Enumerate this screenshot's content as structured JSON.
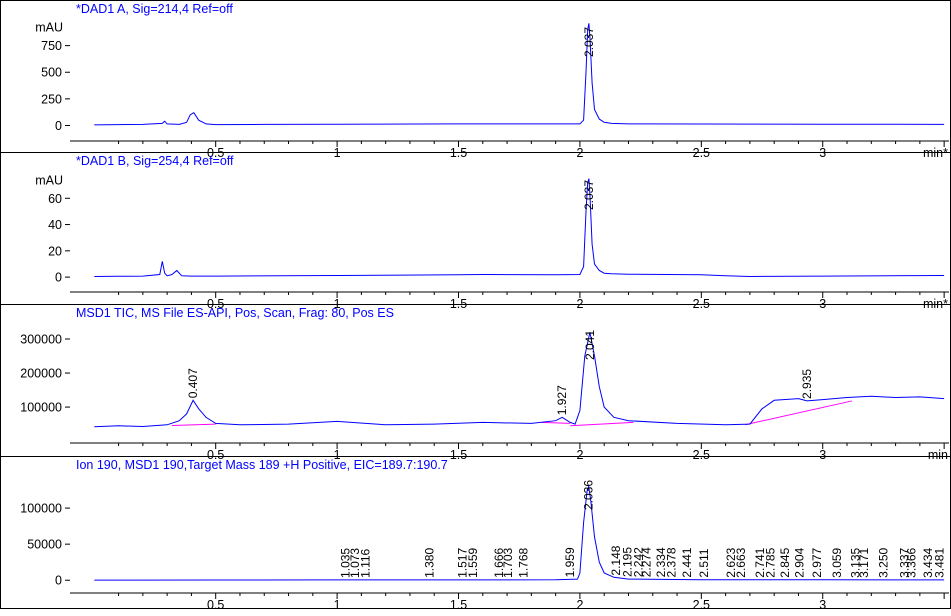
{
  "chart_data": [
    {
      "type": "line",
      "title": "*DAD1 A, Sig=214,4 Ref=off",
      "ylabel": "mAU",
      "xunit": "min*",
      "xlim": [
        -0.1,
        3.52
      ],
      "ylim": [
        -80,
        1000
      ],
      "yticks": [
        0,
        250,
        500,
        750
      ],
      "xticks": [
        0.5,
        1,
        1.5,
        2,
        2.5,
        3
      ],
      "trace_color": "#0000ff",
      "baseline_color": "#ff00ff",
      "series": [
        {
          "x": [
            0,
            0.1,
            0.2,
            0.28,
            0.29,
            0.3,
            0.35,
            0.38,
            0.395,
            0.41,
            0.43,
            0.46,
            0.5,
            0.7,
            1.0,
            1.5,
            1.9,
            2.0,
            2.015,
            2.025,
            2.032,
            2.037,
            2.042,
            2.05,
            2.06,
            2.08,
            2.1,
            2.13,
            2.2,
            2.5,
            3.0,
            3.5
          ],
          "y": [
            5,
            8,
            10,
            20,
            40,
            15,
            10,
            30,
            100,
            120,
            50,
            15,
            8,
            10,
            12,
            15,
            15,
            15,
            50,
            500,
            900,
            960,
            800,
            400,
            150,
            60,
            30,
            20,
            15,
            14,
            12,
            10
          ]
        }
      ],
      "peaks": [
        {
          "rt": 2.037,
          "label": "2.037"
        }
      ]
    },
    {
      "type": "line",
      "title": "*DAD1 B, Sig=254,4 Ref=off",
      "ylabel": "mAU",
      "xunit": "min*",
      "xlim": [
        -0.1,
        3.52
      ],
      "ylim": [
        -6,
        80
      ],
      "yticks": [
        0,
        20,
        40,
        60
      ],
      "xticks": [
        0.5,
        1,
        1.5,
        2,
        2.5,
        3
      ],
      "trace_color": "#0000ff",
      "baseline_color": "#ff00ff",
      "series": [
        {
          "x": [
            0,
            0.1,
            0.2,
            0.27,
            0.28,
            0.29,
            0.3,
            0.32,
            0.34,
            0.36,
            0.4,
            0.5,
            1.0,
            1.5,
            1.6,
            1.9,
            2.0,
            2.015,
            2.025,
            2.032,
            2.037,
            2.042,
            2.05,
            2.06,
            2.08,
            2.1,
            2.13,
            2.2,
            2.5,
            2.6,
            2.7,
            3.0,
            3.5
          ],
          "y": [
            0.5,
            0.6,
            0.8,
            2,
            12,
            3,
            1,
            2,
            5,
            1,
            0.8,
            0.8,
            1.2,
            1.8,
            2,
            1.8,
            2,
            8,
            50,
            72,
            75,
            60,
            25,
            10,
            5,
            3,
            2.5,
            2.2,
            1.8,
            1.0,
            0.5,
            0.8,
            1.2
          ]
        }
      ],
      "peaks": [
        {
          "rt": 2.037,
          "label": "2.037"
        }
      ]
    },
    {
      "type": "line",
      "title": "MSD1 TIC, MS File     ES-API, Pos, Scan, Frag: 80, Pos ES",
      "ylabel": "",
      "xunit": "min",
      "xlim": [
        -0.1,
        3.52
      ],
      "ylim": [
        15000,
        350000
      ],
      "yticks": [
        100000,
        200000,
        300000
      ],
      "xticks": [
        0.5,
        1,
        1.5,
        2,
        2.5,
        3
      ],
      "trace_color": "#0000ff",
      "baseline_color": "#ff00ff",
      "series": [
        {
          "x": [
            0,
            0.1,
            0.2,
            0.3,
            0.35,
            0.38,
            0.407,
            0.43,
            0.46,
            0.5,
            0.6,
            0.8,
            1.0,
            1.2,
            1.4,
            1.6,
            1.8,
            1.9,
            1.927,
            1.96,
            1.98,
            2.0,
            2.02,
            2.041,
            2.06,
            2.08,
            2.1,
            2.14,
            2.2,
            2.4,
            2.6,
            2.7,
            2.75,
            2.8,
            2.9,
            2.935,
            3.0,
            3.1,
            3.2,
            3.3,
            3.4,
            3.5
          ],
          "y": [
            42000,
            45000,
            43000,
            48000,
            60000,
            80000,
            120000,
            95000,
            70000,
            52000,
            48000,
            50000,
            58000,
            48000,
            50000,
            55000,
            52000,
            60000,
            70000,
            55000,
            50000,
            90000,
            250000,
            320000,
            250000,
            160000,
            100000,
            70000,
            60000,
            52000,
            48000,
            50000,
            95000,
            120000,
            125000,
            118000,
            122000,
            128000,
            132000,
            128000,
            130000,
            125000
          ]
        }
      ],
      "baselines": [
        {
          "x": [
            0.32,
            0.5
          ],
          "y": [
            46000,
            50000
          ]
        },
        {
          "x": [
            1.84,
            1.96
          ],
          "y": [
            55000,
            52000
          ]
        },
        {
          "x": [
            1.96,
            2.22
          ],
          "y": [
            45000,
            55000
          ]
        },
        {
          "x": [
            2.68,
            3.12
          ],
          "y": [
            48000,
            118000
          ]
        }
      ],
      "peaks": [
        {
          "rt": 0.407,
          "label": "0.407"
        },
        {
          "rt": 1.927,
          "label": "1.927"
        },
        {
          "rt": 2.041,
          "label": "2.041"
        },
        {
          "rt": 2.935,
          "label": "2.935"
        }
      ]
    },
    {
      "type": "line",
      "title": "Ion 190, MSD1 190,Target Mass 189 +H Positive, EIC=189.7:190.7",
      "ylabel": "",
      "xunit": "",
      "xlim": [
        -0.1,
        3.52
      ],
      "ylim": [
        -8000,
        150000
      ],
      "yticks": [
        0,
        50000,
        100000
      ],
      "xticks": [
        0.5,
        1,
        1.5,
        2,
        2.5,
        3
      ],
      "trace_color": "#0000ff",
      "baseline_color": "#ff00ff",
      "series": [
        {
          "x": [
            0,
            0.5,
            1.0,
            1.5,
            1.9,
            1.99,
            2.0,
            2.015,
            2.03,
            2.036,
            2.045,
            2.06,
            2.08,
            2.1,
            2.14,
            2.2,
            2.5,
            3.0,
            3.5
          ],
          "y": [
            200,
            300,
            400,
            500,
            600,
            1500,
            10000,
            80000,
            125000,
            130000,
            110000,
            60000,
            25000,
            10000,
            4000,
            1500,
            800,
            600,
            500
          ]
        }
      ],
      "peaks": [
        {
          "rt": 1.035,
          "label": "1.035"
        },
        {
          "rt": 1.073,
          "label": "1.073"
        },
        {
          "rt": 1.116,
          "label": "1.116"
        },
        {
          "rt": 1.38,
          "label": "1.380"
        },
        {
          "rt": 1.517,
          "label": "1.517"
        },
        {
          "rt": 1.559,
          "label": "1.559"
        },
        {
          "rt": 1.666,
          "label": "1.666"
        },
        {
          "rt": 1.703,
          "label": "1.703"
        },
        {
          "rt": 1.768,
          "label": "1.768"
        },
        {
          "rt": 1.959,
          "label": "1.959"
        },
        {
          "rt": 2.036,
          "label": "2.036"
        },
        {
          "rt": 2.148,
          "label": "2.148"
        },
        {
          "rt": 2.195,
          "label": "2.195"
        },
        {
          "rt": 2.242,
          "label": "2.242"
        },
        {
          "rt": 2.274,
          "label": "2.274"
        },
        {
          "rt": 2.334,
          "label": "2.334"
        },
        {
          "rt": 2.378,
          "label": "2.378"
        },
        {
          "rt": 2.441,
          "label": "2.441"
        },
        {
          "rt": 2.511,
          "label": "2.511"
        },
        {
          "rt": 2.623,
          "label": "2.623"
        },
        {
          "rt": 2.663,
          "label": "2.663"
        },
        {
          "rt": 2.741,
          "label": "2.741"
        },
        {
          "rt": 2.785,
          "label": "2.785"
        },
        {
          "rt": 2.845,
          "label": "2.845"
        },
        {
          "rt": 2.904,
          "label": "2.904"
        },
        {
          "rt": 2.977,
          "label": "2.977"
        },
        {
          "rt": 3.059,
          "label": "3.059"
        },
        {
          "rt": 3.135,
          "label": "3.135"
        },
        {
          "rt": 3.171,
          "label": "3.171"
        },
        {
          "rt": 3.25,
          "label": "3.250"
        },
        {
          "rt": 3.337,
          "label": "3.337"
        },
        {
          "rt": 3.366,
          "label": "3.366"
        },
        {
          "rt": 3.434,
          "label": "3.434"
        },
        {
          "rt": 3.481,
          "label": "3.481"
        }
      ]
    }
  ]
}
